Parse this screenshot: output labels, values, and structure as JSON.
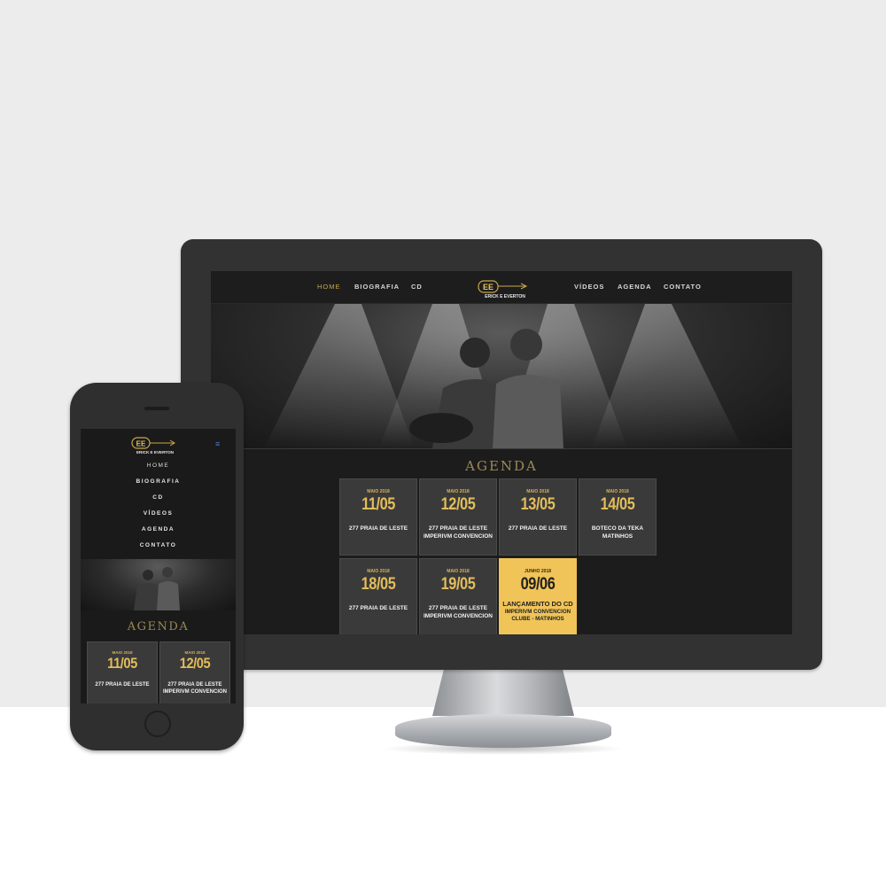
{
  "brand": {
    "name": "ERICK E EVERTON",
    "mark": "EE",
    "gold": "#c9a84a",
    "card_highlight": "#f0c458"
  },
  "nav": {
    "items": [
      "HOME",
      "BIOGRAFIA",
      "CD",
      "VÍDEOS",
      "AGENDA",
      "CONTATO"
    ],
    "active": "HOME"
  },
  "mobile": {
    "menu_icon": "hamburger-icon",
    "menu_items": [
      "HOME",
      "BIOGRAFIA",
      "CD",
      "VÍDEOS",
      "AGENDA",
      "CONTATO"
    ]
  },
  "agenda": {
    "title": "AGENDA",
    "events": [
      {
        "month": "MAIO 2018",
        "day": "11/05",
        "venue": "277 PRAIA DE LESTE"
      },
      {
        "month": "MAIO 2018",
        "day": "12/05",
        "venue": "277 PRAIA DE LESTE\nIMPERIVM CONVENCION"
      },
      {
        "month": "MAIO 2018",
        "day": "13/05",
        "venue": "277 PRAIA DE LESTE"
      },
      {
        "month": "MAIO 2018",
        "day": "14/05",
        "venue": "BOTECO DA TEKA\nMATINHOS"
      },
      {
        "month": "MAIO 2018",
        "day": "18/05",
        "venue": "277 PRAIA DE LESTE"
      },
      {
        "month": "MAIO 2018",
        "day": "19/05",
        "venue": "277 PRAIA DE LESTE\nIMPERIVM CONVENCION"
      },
      {
        "month": "JUNHO 2018",
        "day": "09/06",
        "venue": "LANÇAMENTO DO CD",
        "venue2": "IMPERIVM CONVENCION\nCLUBE - MATINHOS",
        "highlight": true
      }
    ]
  }
}
